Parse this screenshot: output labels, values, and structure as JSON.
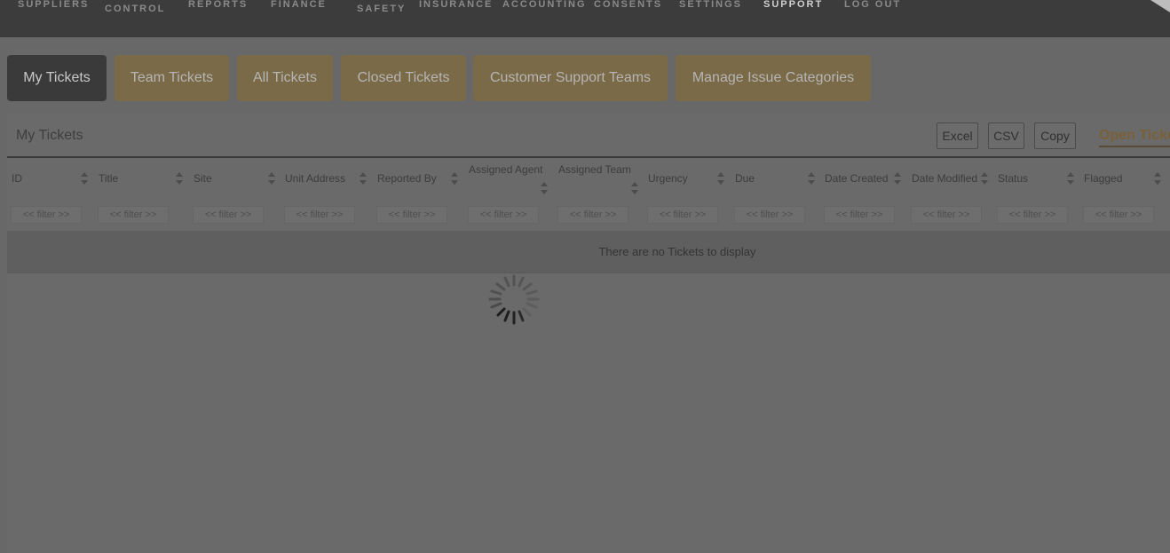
{
  "nav": {
    "items": [
      {
        "label": "SUPPLIERS"
      },
      {
        "label": "CONTROL"
      },
      {
        "label": "REPORTS"
      },
      {
        "label": "FINANCE"
      },
      {
        "label": "SAFETY"
      },
      {
        "label": "INSURANCE"
      },
      {
        "label": "ACCOUNTING"
      },
      {
        "label": "CONSENTS"
      },
      {
        "label": "SETTINGS"
      },
      {
        "label": "SUPPORT"
      },
      {
        "label": "LOG OUT"
      }
    ],
    "active": "SUPPORT"
  },
  "tabs": [
    {
      "label": "My Tickets"
    },
    {
      "label": "Team Tickets"
    },
    {
      "label": "All Tickets"
    },
    {
      "label": "Closed Tickets"
    },
    {
      "label": "Customer Support Teams"
    },
    {
      "label": "Manage Issue Categories"
    }
  ],
  "active_tab": "My Tickets",
  "panel": {
    "title": "My Tickets",
    "buttons": {
      "excel": "Excel",
      "csv": "CSV",
      "copy": "Copy"
    },
    "open_link": "Open Ticke"
  },
  "table": {
    "columns": [
      {
        "label": "ID"
      },
      {
        "label": "Title"
      },
      {
        "label": "Site"
      },
      {
        "label": "Unit Address"
      },
      {
        "label": "Reported By"
      },
      {
        "label": "Assigned Agent"
      },
      {
        "label": "Assigned Team"
      },
      {
        "label": "Urgency"
      },
      {
        "label": "Due"
      },
      {
        "label": "Date Created"
      },
      {
        "label": "Date Modified"
      },
      {
        "label": "Status"
      },
      {
        "label": "Flagged"
      }
    ],
    "filter_placeholder": "<< filter >>",
    "empty_message": "There are no Tickets to display"
  },
  "colors": {
    "nav_bg": "#3c3c3c",
    "tab_bg": "#7a6a47",
    "tab_active_bg": "#3a3a3a",
    "overlay_bg": "#686868"
  }
}
